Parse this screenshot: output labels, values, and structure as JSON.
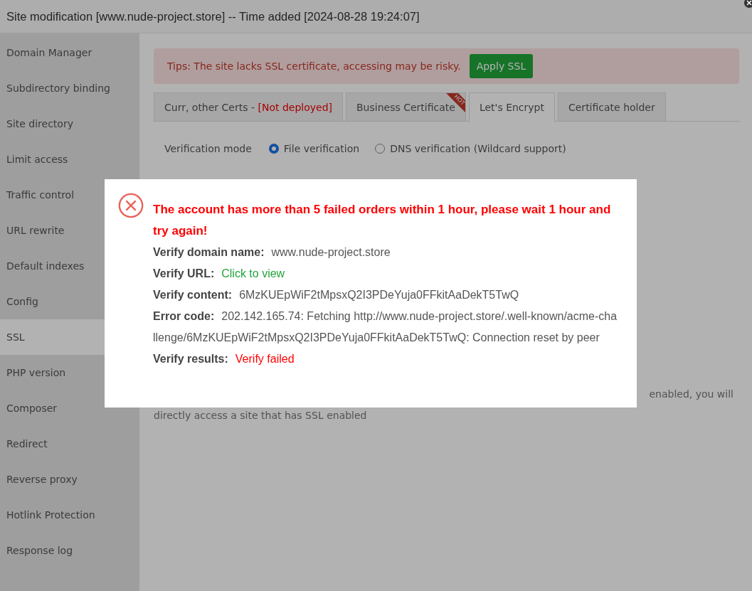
{
  "window": {
    "title": "Site modification [www.nude-project.store] -- Time added [2024-08-28 19:24:07]"
  },
  "sidebar": {
    "items": [
      {
        "label": "Domain Manager",
        "selected": false
      },
      {
        "label": "Subdirectory binding",
        "selected": false
      },
      {
        "label": "Site directory",
        "selected": false
      },
      {
        "label": "Limit access",
        "selected": false
      },
      {
        "label": "Traffic control",
        "selected": false
      },
      {
        "label": "URL rewrite",
        "selected": false
      },
      {
        "label": "Default indexes",
        "selected": false
      },
      {
        "label": "Config",
        "selected": false
      },
      {
        "label": "SSL",
        "selected": true
      },
      {
        "label": "PHP version",
        "selected": false
      },
      {
        "label": "Composer",
        "selected": false
      },
      {
        "label": "Redirect",
        "selected": false
      },
      {
        "label": "Reverse proxy",
        "selected": false
      },
      {
        "label": "Hotlink Protection",
        "selected": false
      },
      {
        "label": "Response log",
        "selected": false
      }
    ]
  },
  "tip": {
    "text": "Tips: The site lacks SSL certificate, accessing may be risky.",
    "button": "Apply SSL"
  },
  "tabs": [
    {
      "label": "Curr, other Certs - ",
      "status": "[Not deployed]",
      "selected": false
    },
    {
      "label": "Business Certificate",
      "badge": "HOT",
      "selected": false
    },
    {
      "label": "Let's Encrypt",
      "selected": true
    },
    {
      "label": "Certificate holder",
      "selected": false
    }
  ],
  "verification": {
    "label": "Verification mode",
    "options": [
      {
        "label": "File verification",
        "selected": true
      },
      {
        "label": "DNS verification (Wildcard support)",
        "selected": false
      }
    ]
  },
  "note": [
    "enabled, you will",
    "directly access a site that has SSL enabled"
  ],
  "dialog": {
    "message": "The account has more than 5 failed orders within 1 hour, please wait 1 hour and try again!",
    "fields": [
      {
        "label": "Verify domain name:",
        "value": "www.nude-project.store",
        "kind": "text"
      },
      {
        "label": "Verify URL:",
        "value": "Click to view",
        "kind": "link"
      },
      {
        "label": "Verify content:",
        "value": "6MzKUEpWiF2tMpsxQ2I3PDeYuja0FFkitAaDekT5TwQ",
        "kind": "text"
      },
      {
        "label": "Error code:",
        "value": "202.142.165.74: Fetching http://www.nude-project.store/.well-known/acme-challenge/6MzKUEpWiF2tMpsxQ2I3PDeYuja0FFkitAaDekT5TwQ: Connection reset by peer",
        "kind": "text"
      },
      {
        "label": "Verify results:",
        "value": "Verify failed",
        "kind": "error"
      }
    ]
  }
}
